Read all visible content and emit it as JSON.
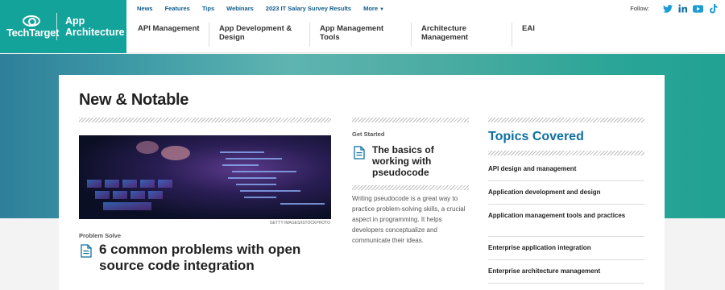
{
  "brand": {
    "logo_text": "TechTarget",
    "site_name_line1": "App",
    "site_name_line2": "Architecture",
    "color": "#14a39a"
  },
  "utility_nav": {
    "links": [
      "News",
      "Features",
      "Tips",
      "Webinars",
      "2023 IT Salary Survey Results",
      "More"
    ]
  },
  "follow": {
    "label": "Follow:",
    "icons": [
      "twitter-icon",
      "linkedin-icon",
      "youtube-icon",
      "tiktok-icon"
    ]
  },
  "main_nav": {
    "items": [
      "API Management",
      "App Development & Design",
      "App Management Tools",
      "Architecture Management",
      "EAI"
    ]
  },
  "new_and_notable": {
    "title": "New & Notable",
    "image_caption": "GETTY IMAGES/ISTOCKPHOTO",
    "feature": {
      "kicker": "Problem Solve",
      "headline": "6 common problems with open source code integration"
    },
    "secondary": {
      "kicker": "Get Started",
      "headline": "The basics of working with pseudocode",
      "teaser": "Writing pseudocode is a great way to practice problem-solving skills, a crucial aspect in programming. It helps developers conceptualize and communicate their ideas."
    }
  },
  "topics": {
    "title": "Topics Covered",
    "items": [
      "API design and management",
      "Application development and design",
      "Application management tools and practices",
      "Enterprise application integration",
      "Enterprise architecture management"
    ]
  },
  "colors": {
    "accent": "#14a39a",
    "link_blue": "#0d5b8c",
    "topics_blue": "#0f6fa0"
  }
}
